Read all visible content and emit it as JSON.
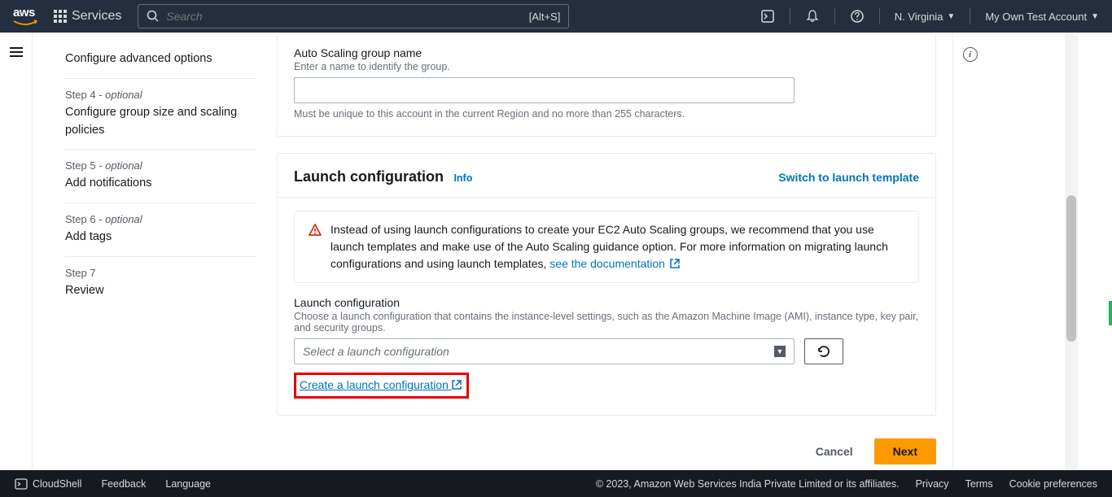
{
  "header": {
    "services": "Services",
    "search_placeholder": "Search",
    "search_shortcut": "[Alt+S]",
    "region": "N. Virginia",
    "account": "My Own Test Account"
  },
  "sidebar": {
    "steps": [
      {
        "label": "",
        "title": "Configure advanced options"
      },
      {
        "label": "Step 4 - ",
        "optional": "optional",
        "title": "Configure group size and scaling policies"
      },
      {
        "label": "Step 5 - ",
        "optional": "optional",
        "title": "Add notifications"
      },
      {
        "label": "Step 6 - ",
        "optional": "optional",
        "title": "Add tags"
      },
      {
        "label": "Step 7",
        "title": "Review"
      }
    ]
  },
  "form": {
    "asg_name_label": "Auto Scaling group name",
    "asg_name_desc": "Enter a name to identify the group.",
    "asg_name_hint": "Must be unique to this account in the current Region and no more than 255 characters.",
    "lc_title": "Launch configuration",
    "info_label": "Info",
    "switch_link": "Switch to launch template",
    "warning_text_1": "Instead of using launch configurations to create your EC2 Auto Scaling groups, we recommend that you use launch templates and make use of the Auto Scaling guidance option. For more information on migrating launch configurations and using launch templates, ",
    "warning_doc_link": "see the documentation",
    "lc_field_label": "Launch configuration",
    "lc_field_desc": "Choose a launch configuration that contains the instance-level settings, such as the Amazon Machine Image (AMI), instance type, key pair, and security groups.",
    "lc_select_placeholder": "Select a launch configuration",
    "create_lc_link": "Create a launch configuration",
    "cancel_btn": "Cancel",
    "next_btn": "Next"
  },
  "footer": {
    "cloudshell": "CloudShell",
    "feedback": "Feedback",
    "language": "Language",
    "copyright": "© 2023, Amazon Web Services India Private Limited or its affiliates.",
    "privacy": "Privacy",
    "terms": "Terms",
    "cookies": "Cookie preferences"
  }
}
